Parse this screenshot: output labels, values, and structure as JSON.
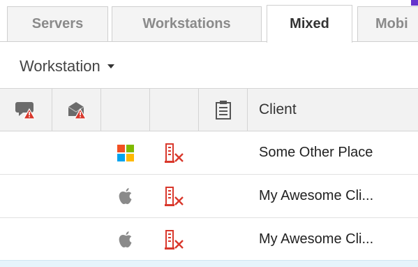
{
  "tabs": [
    {
      "label": "Servers",
      "active": false
    },
    {
      "label": "Workstations",
      "active": false
    },
    {
      "label": "Mixed",
      "active": true
    },
    {
      "label": "Mobi",
      "active": false
    }
  ],
  "filter": {
    "label": "Workstation"
  },
  "grid": {
    "columns": {
      "client": "Client"
    },
    "header_icons": [
      "chat-alert-icon",
      "mail-alert-icon",
      "",
      "",
      "clipboard-list-icon"
    ],
    "rows": [
      {
        "os_icon": "windows-icon",
        "status_icon": "server-error-icon",
        "client": "Some Other Place"
      },
      {
        "os_icon": "apple-icon",
        "status_icon": "server-error-icon",
        "client": "My Awesome Cli..."
      },
      {
        "os_icon": "apple-icon",
        "status_icon": "server-error-icon",
        "client": "My Awesome Cli..."
      }
    ]
  },
  "colors": {
    "accent": "#6633cc",
    "error": "#d9382c",
    "selected_row": "#e6f4fb"
  }
}
